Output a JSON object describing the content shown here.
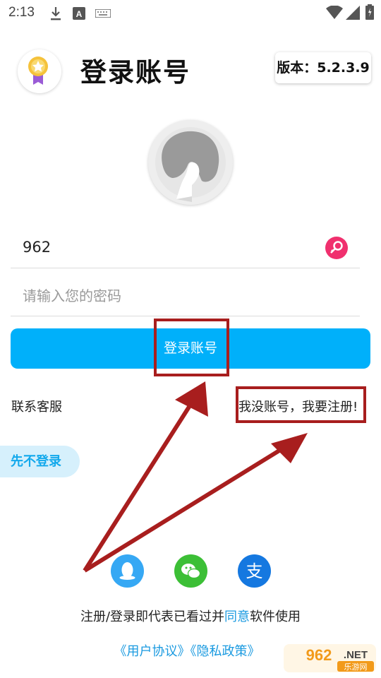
{
  "status_bar": {
    "time": "2:13",
    "icons": [
      "download-icon",
      "keyboard-a-icon",
      "keyboard-icon",
      "wifi-icon",
      "signal-icon",
      "battery-icon"
    ]
  },
  "header": {
    "title": "登录账号",
    "version": "版本：5.2.3.9",
    "logo_icon": "medal-icon"
  },
  "avatar": {
    "icon": "woman-silhouette-icon"
  },
  "form": {
    "username_value": "962",
    "password_placeholder": "请输入您的密码",
    "login_label": "登录账号"
  },
  "links": {
    "customer_service": "联系客服",
    "register": "我没账号，我要注册!"
  },
  "skip_label": "先不登录",
  "social": [
    {
      "name": "qq-icon",
      "color": "#36a8f4"
    },
    {
      "name": "wechat-icon",
      "color": "#3cbf36"
    },
    {
      "name": "alipay-icon",
      "color": "#1578e0"
    }
  ],
  "footer": {
    "agreement_prefix": "注册/登录即代表已看过并",
    "agree_link": "同意",
    "agreement_suffix": "软件使用",
    "user_agreement": "《用户协议》",
    "privacy_policy": "《隐私政策》"
  },
  "watermark": {
    "brand": "962.NET",
    "sub": "乐游网"
  },
  "colors": {
    "accent": "#00b0fa",
    "link": "#1a9ae0",
    "annotation": "#a81e1e"
  }
}
